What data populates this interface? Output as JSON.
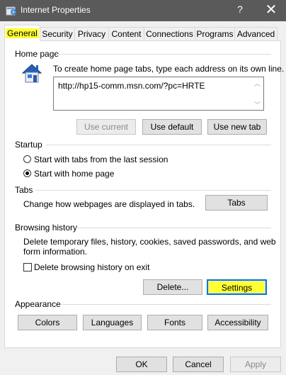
{
  "window": {
    "title": "Internet Properties",
    "help_glyph": "?",
    "close_glyph": "✕"
  },
  "tabs": [
    {
      "label": "General",
      "active": true
    },
    {
      "label": "Security"
    },
    {
      "label": "Privacy"
    },
    {
      "label": "Content"
    },
    {
      "label": "Connections"
    },
    {
      "label": "Programs"
    },
    {
      "label": "Advanced"
    }
  ],
  "home_page": {
    "heading": "Home page",
    "instruction": "To create home page tabs, type each address on its own line.",
    "url_value": "http://hp15-comm.msn.com/?pc=HRTE",
    "use_current": "Use current",
    "use_default": "Use default",
    "use_new_tab": "Use new tab"
  },
  "startup": {
    "heading": "Startup",
    "option_last_session": "Start with tabs from the last session",
    "option_home_page": "Start with home page",
    "selected": "home_page"
  },
  "tabs_section": {
    "heading": "Tabs",
    "description": "Change how webpages are displayed in tabs.",
    "button": "Tabs"
  },
  "browsing_history": {
    "heading": "Browsing history",
    "description_line1": "Delete temporary files, history, cookies, saved passwords, and web",
    "description_line2": "form information.",
    "delete_on_exit": "Delete browsing history on exit",
    "delete_on_exit_checked": false,
    "delete_button": "Delete...",
    "settings_button": "Settings"
  },
  "appearance": {
    "heading": "Appearance",
    "colors": "Colors",
    "languages": "Languages",
    "fonts": "Fonts",
    "accessibility": "Accessibility"
  },
  "footer": {
    "ok": "OK",
    "cancel": "Cancel",
    "apply": "Apply"
  },
  "colors": {
    "titlebar": "#5a5a5a",
    "highlight": "#ffff33",
    "focus_border": "#0078d7"
  }
}
